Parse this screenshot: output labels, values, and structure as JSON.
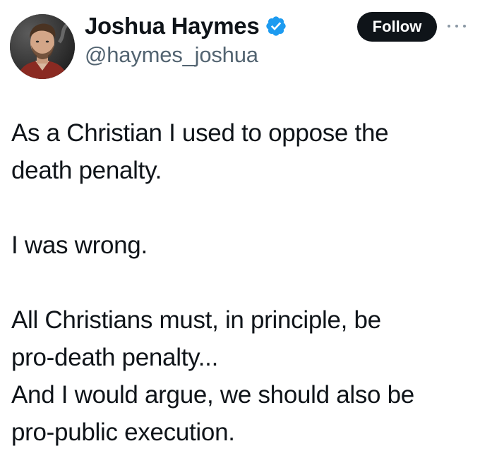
{
  "author": {
    "display_name": "Joshua Haymes",
    "handle": "@haymes_joshua",
    "verified": true,
    "verified_icon": "verified-badge-icon",
    "verified_color": "#1d9bf0"
  },
  "actions": {
    "follow_label": "Follow",
    "more_icon": "more-options-icon"
  },
  "tweet": {
    "paragraphs": [
      [
        "As a Christian I used to oppose the",
        "death penalty."
      ],
      [
        "I was wrong."
      ],
      [
        "All Christians must, in principle, be",
        "pro-death penalty...",
        "And I would argue, we should also be",
        "pro-public execution."
      ]
    ]
  },
  "colors": {
    "text": "#0f1419",
    "secondary_text": "#536471",
    "follow_bg": "#0f1419",
    "follow_text": "#ffffff"
  }
}
